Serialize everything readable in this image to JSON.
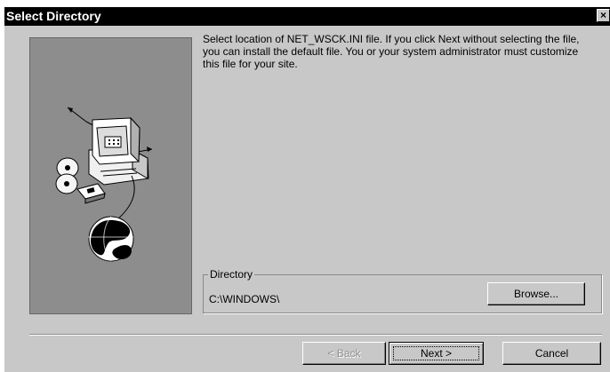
{
  "window": {
    "title": "Select Directory",
    "close_label": "×"
  },
  "content": {
    "instruction": "Select location of NET_WSCK.INI file.  If you click Next without selecting the file, you can install the default file.  You or your system administrator must customize this file for your site."
  },
  "directory": {
    "group_label": "Directory",
    "path": "C:\\WINDOWS\\"
  },
  "buttons": {
    "browse": "Browse...",
    "back": "< Back",
    "next": "Next >",
    "cancel": "Cancel"
  },
  "icons": {
    "computer": "computer-icon",
    "disc": "disc-icon",
    "disk": "floppy-disk-icon",
    "globe": "globe-icon",
    "close": "close-icon"
  },
  "colors": {
    "dialog_background": "#c8c8c8",
    "title_background": "#000000",
    "title_text": "#ffffff",
    "image_panel": "#8d8d8d",
    "disabled_text": "#8f8f8f"
  }
}
